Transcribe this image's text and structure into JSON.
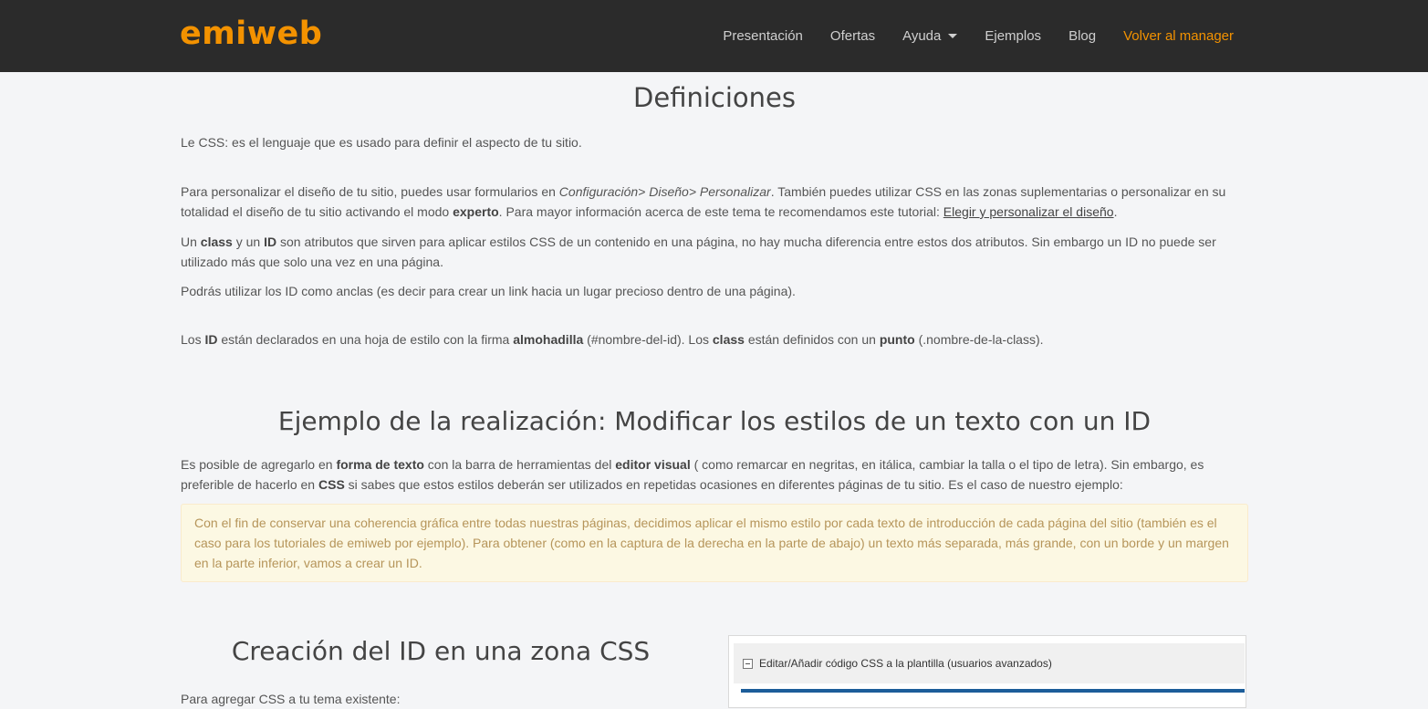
{
  "logo": {
    "part1": "emi",
    "part2": "web"
  },
  "nav": {
    "items": [
      "Presentación",
      "Ofertas",
      "Ayuda",
      "Ejemplos",
      "Blog"
    ],
    "manager": "Volver al manager"
  },
  "defs": {
    "title": "Definiciones",
    "p1": "Le CSS: es el lenguaje que es usado para definir el aspecto de tu sitio.",
    "p2_a": "Para personalizar el diseño de tu sitio, puedes usar formularios en ",
    "p2_em": "Configuración> Diseño> Personalizar",
    "p2_b": ". También puedes utilizar CSS en las zonas suplementarias o personalizar en su totalidad el diseño de tu sitio activando el modo ",
    "p2_bold": "experto",
    "p2_c": ". Para mayor información acerca de este tema te recomendamos este tutorial: ",
    "p2_link": "Elegir y personalizar el diseño",
    "p2_d": ".",
    "p3_a": "Un ",
    "p3_class": "class",
    "p3_b": " y un ",
    "p3_id": "ID",
    "p3_c": " son atributos que sirven para aplicar estilos CSS de un contenido en una página, no hay mucha diferencia entre estos dos atributos. Sin embargo un ID no puede ser utilizado más que solo una vez en una página.",
    "p4": "Podrás utilizar los ID como anclas (es decir para crear un link hacia un lugar precioso dentro de una página).",
    "p5_a": "Los ",
    "p5_id": "ID",
    "p5_b": " están declarados en una hoja de estilo con la firma ",
    "p5_alm": "almohadilla",
    "p5_c": " (#nombre-del-id). Los ",
    "p5_class": "class",
    "p5_d": " están definidos con un ",
    "p5_punto": "punto",
    "p5_e": " (.nombre-de-la-class)."
  },
  "example": {
    "title": "Ejemplo de la realización: Modificar los estilos de un texto con un ID",
    "p_a": "Es posible de agregarlo en ",
    "p_forma": "forma de texto",
    "p_b": " con la barra de herramientas del ",
    "p_editor": "editor visual",
    "p_c": " ( como remarcar en negritas, en itálica, cambiar la talla o el tipo de letra). Sin embargo, es preferible de hacerlo en ",
    "p_css": "CSS",
    "p_d": " si sabes que estos estilos deberán ser utilizados en repetidas ocasiones en diferentes páginas de tu sitio. Es el caso de nuestro ejemplo:",
    "notice": "Con el fin de conservar una coherencia gráfica entre todas nuestras páginas, decidimos aplicar el mismo estilo por cada texto de introducción de cada página del sitio (también es el caso para los tutoriales de emiweb por ejemplo). Para obtener (como en la captura de la derecha en la parte de abajo) un texto más separada, más grande, con un borde y un margen en la parte inferior, vamos a crear un ID."
  },
  "creation": {
    "title": "Creación del ID en una zona CSS",
    "cut_text": "Para agregar CSS a tu tema existente:",
    "screenshot_label": "Editar/Añadir código CSS a la plantilla (usuarios avanzados)"
  }
}
